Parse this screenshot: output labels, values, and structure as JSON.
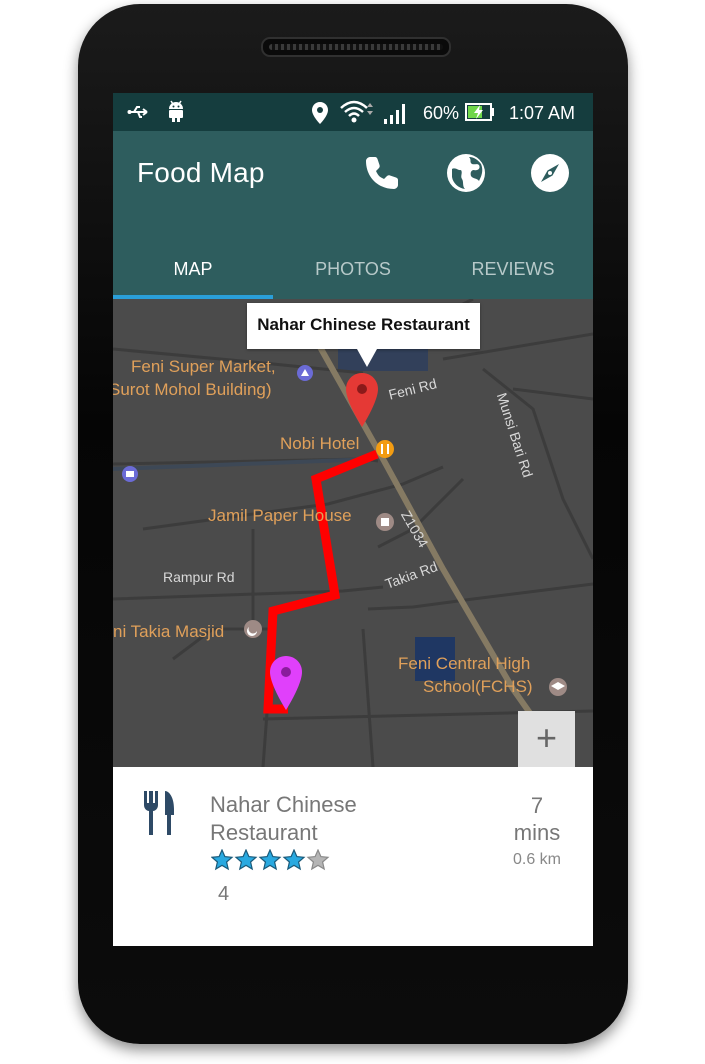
{
  "status_bar": {
    "battery": "60%",
    "time": "1:07 AM",
    "icons": [
      "usb-icon",
      "android-icon",
      "location-icon",
      "wifi-icon",
      "signal-icon",
      "battery-charging-icon"
    ]
  },
  "app_bar": {
    "title": "Food Map",
    "actions": [
      "phone-icon",
      "globe-icon",
      "compass-icon"
    ]
  },
  "tabs": [
    {
      "label": "MAP",
      "active": true
    },
    {
      "label": "PHOTOS",
      "active": false
    },
    {
      "label": "REVIEWS",
      "active": false
    }
  ],
  "map": {
    "tooltip": "Nahar Chinese Restaurant",
    "places": {
      "feni_super_market": "Feni Super Market,",
      "surot_mohol": "Surot Mohol Building)",
      "nobi_hotel": "Nobi Hotel",
      "jamil_paper": "Jamil Paper House",
      "takia_masjid": "ni Takia Masjid",
      "feni_central_1": "Feni Central High",
      "feni_central_2": "School(FCHS)"
    },
    "roads": {
      "feni_rd": "Feni Rd",
      "munsi_bari_rd": "Munsi Bari Rd",
      "z1034": "Z1034",
      "rampur_rd": "Rampur Rd",
      "takia_rd": "Takia Rd"
    },
    "zoom_label": "+",
    "route_color": "#ff0000",
    "destination_pin_color": "#e53935",
    "origin_pin_color": "#e040fb"
  },
  "card": {
    "icon": "restaurant-icon",
    "name": "Nahar Chinese Restaurant",
    "rating": "4",
    "rating_stars_filled": 4,
    "rating_stars_total": 5,
    "eta_value": "7",
    "eta_unit": "mins",
    "distance": "0.6 km"
  },
  "colors": {
    "status_bar": "#153d3e",
    "app_bar": "#2e5d5e",
    "tab_indicator": "#2a9fd9",
    "star": "#29a9e0"
  }
}
